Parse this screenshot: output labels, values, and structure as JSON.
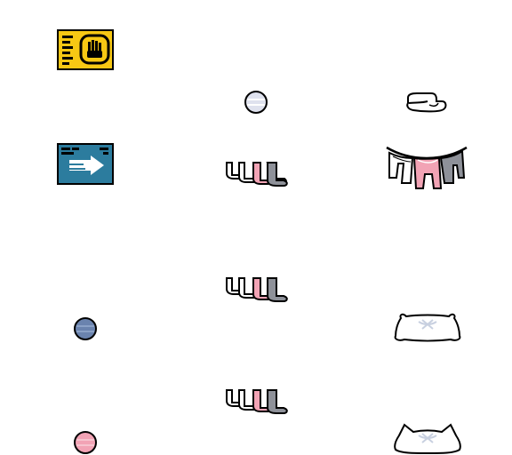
{
  "sheet": {
    "sprites": [
      {
        "name": "stop-hand-sign-icon"
      },
      {
        "name": "lavender-ball-icon"
      },
      {
        "name": "white-sock-icon"
      },
      {
        "name": "blue-arrow-sign-icon"
      },
      {
        "name": "sock-row-icon"
      },
      {
        "name": "hanging-laundry-line-icon"
      },
      {
        "name": "sock-row-icon"
      },
      {
        "name": "blue-ball-icon"
      },
      {
        "name": "pillow-icon"
      },
      {
        "name": "sock-row-icon"
      },
      {
        "name": "pink-ball-icon"
      },
      {
        "name": "cat-pillow-icon"
      }
    ],
    "colors": {
      "outline": "#000000",
      "yellow_sign": "#f7c814",
      "blue_sign": "#2c7c9e",
      "lavender": "#dfe2ee",
      "blue_ball": "#6a83ae",
      "pink": "#f2a3b5",
      "gray": "#8e9199",
      "white": "#ffffff"
    }
  }
}
